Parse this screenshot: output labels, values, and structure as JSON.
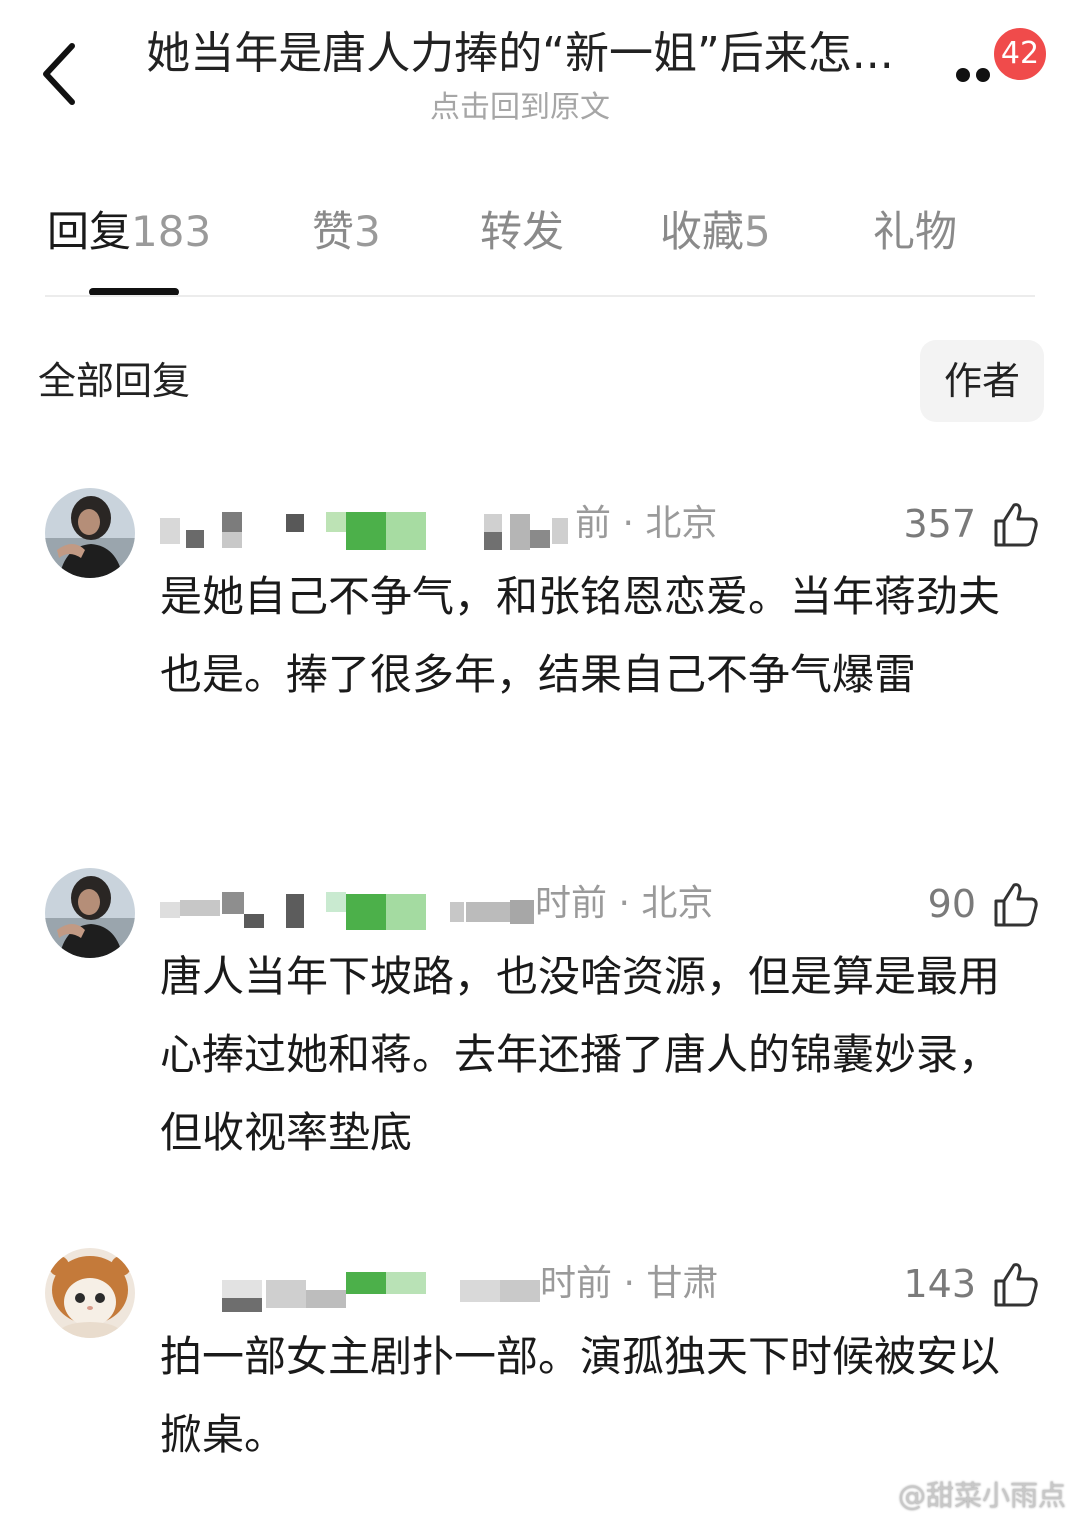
{
  "header": {
    "title": "她当年是唐人力捧的“新一姐”后来怎...",
    "subtitle": "点击回到原文",
    "badge_count": "42",
    "back_icon": "chevron-left-icon",
    "more_icon": "more-dots-icon"
  },
  "tabs": [
    {
      "label": "回复",
      "count": "183",
      "active": true
    },
    {
      "label": "赞",
      "count": "3",
      "active": false
    },
    {
      "label": "转发",
      "count": "",
      "active": false
    },
    {
      "label": "收藏",
      "count": "5",
      "active": false
    },
    {
      "label": "礼物",
      "count": "",
      "active": false
    }
  ],
  "filter": {
    "label": "全部回复",
    "author_button": "作者"
  },
  "comments": [
    {
      "meta": "前 · 北京",
      "likes": "357",
      "text": "是她自己不争气，和张铭恩恋爱。当年蒋劲夫也是。捧了很多年，结果自己不争气爆雷"
    },
    {
      "meta": "时前 · 北京",
      "likes": "90",
      "text": "唐人当年下坡路，也没啥资源，但是算是最用心捧过她和蒋。去年还播了唐人的锦囊妙录，但收视率垫底"
    },
    {
      "meta": "时前 · 甘肃",
      "likes": "143",
      "text": "拍一部女主剧扑一部。演孤独天下时候被安以掀桌。"
    }
  ],
  "watermark": "@甜菜小雨点",
  "colors": {
    "badge": "#f04b4b",
    "text_primary": "#1a1a1a",
    "text_secondary": "#9a9a9a",
    "author_button_bg": "#f3f3f3"
  }
}
